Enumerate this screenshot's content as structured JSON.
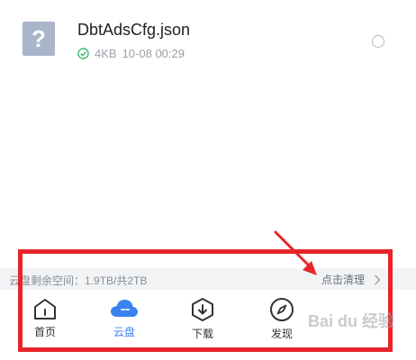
{
  "file": {
    "icon_glyph": "?",
    "name": "DbtAdsCfg.json",
    "size": "4KB",
    "date": "10-08 00:29"
  },
  "storage": {
    "text": "云盘剩余空间：1.9TB/共2TB",
    "clean_label": "点击清理"
  },
  "nav": [
    {
      "label": "首页",
      "icon": "home-icon",
      "active": false
    },
    {
      "label": "云盘",
      "icon": "cloud-icon",
      "active": true
    },
    {
      "label": "下载",
      "icon": "download-icon",
      "active": false
    },
    {
      "label": "发现",
      "icon": "compass-icon",
      "active": false
    }
  ],
  "watermark": "Bai du 经验",
  "colors": {
    "accent": "#3a82f0",
    "highlight_frame": "#e8242b",
    "success": "#3ab86b"
  }
}
